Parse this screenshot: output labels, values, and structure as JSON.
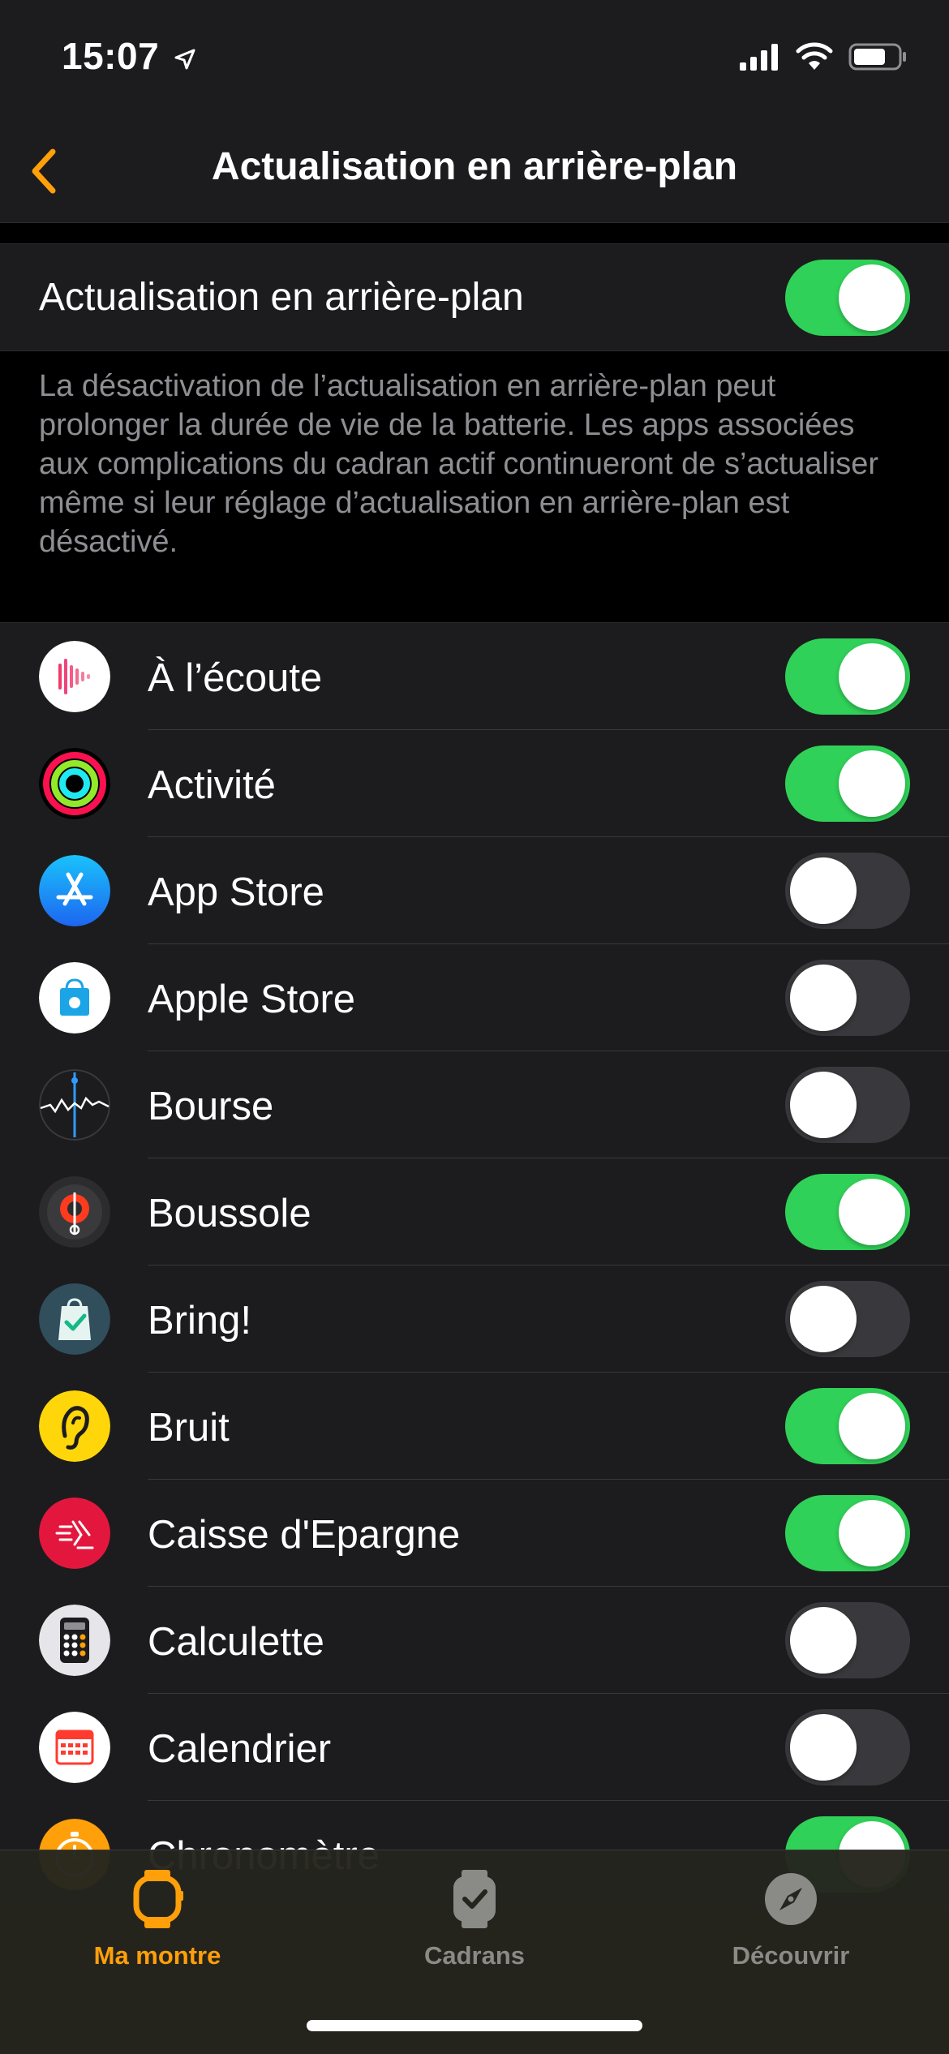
{
  "status_bar": {
    "time": "15:07"
  },
  "nav": {
    "title": "Actualisation en arrière-plan"
  },
  "main_toggle": {
    "label": "Actualisation en arrière-plan",
    "on": true
  },
  "footer": "La désactivation de l’actualisation en arrière-plan peut prolonger la durée de vie de la batterie. Les apps associées aux complications du cadran actif continueront de s’actualiser même si leur réglage d’actualisation en arrière-plan est désactivé.",
  "apps": [
    {
      "label": "À l’écoute",
      "icon": "now-playing-icon",
      "on": true
    },
    {
      "label": "Activité",
      "icon": "activity-icon",
      "on": true
    },
    {
      "label": "App Store",
      "icon": "app-store-icon",
      "on": false
    },
    {
      "label": "Apple Store",
      "icon": "apple-store-icon",
      "on": false
    },
    {
      "label": "Bourse",
      "icon": "stocks-icon",
      "on": false
    },
    {
      "label": "Boussole",
      "icon": "compass-icon",
      "on": true
    },
    {
      "label": "Bring!",
      "icon": "bring-icon",
      "on": false
    },
    {
      "label": "Bruit",
      "icon": "noise-icon",
      "on": true
    },
    {
      "label": "Caisse d'Epargne",
      "icon": "caisse-epargne-icon",
      "on": true
    },
    {
      "label": "Calculette",
      "icon": "calculator-icon",
      "on": false
    },
    {
      "label": "Calendrier",
      "icon": "calendar-icon",
      "on": false
    },
    {
      "label": "Chronomètre",
      "icon": "stopwatch-icon",
      "on": true
    }
  ],
  "tabs": [
    {
      "label": "Ma montre",
      "icon": "watch-icon",
      "active": true
    },
    {
      "label": "Cadrans",
      "icon": "watch-faces-icon",
      "active": false
    },
    {
      "label": "Découvrir",
      "icon": "discover-compass-icon",
      "active": false
    }
  ],
  "colors": {
    "accent": "#ff9f0a",
    "toggle_on": "#30d158",
    "toggle_off": "#39393d"
  }
}
